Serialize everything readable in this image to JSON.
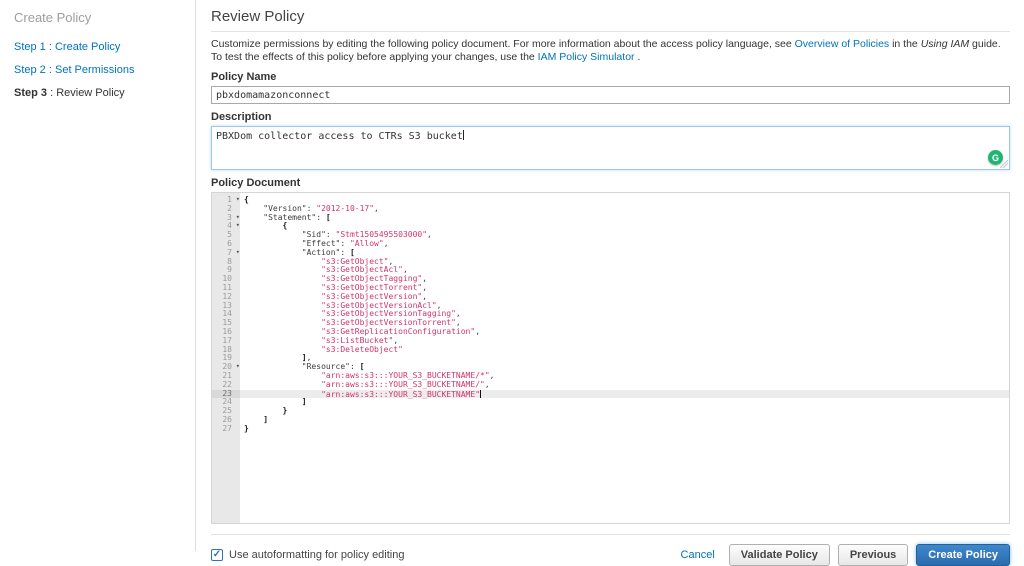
{
  "colors": {
    "link": "#0073bb",
    "string": "#d1356a",
    "primary": "#2e77c0"
  },
  "sidebar": {
    "title": "Create Policy",
    "sep": " : ",
    "steps": [
      {
        "prefix": "Step 1",
        "label": "Create Policy",
        "active": false
      },
      {
        "prefix": "Step 2",
        "label": "Set Permissions",
        "active": false
      },
      {
        "prefix": "Step 3",
        "label": "Review Policy",
        "active": true
      }
    ]
  },
  "header": {
    "title": "Review Policy",
    "intro": [
      {
        "text": "Customize permissions by editing the following policy document. For more information about the access policy language, see "
      },
      {
        "text": "Overview of Policies",
        "style": "link",
        "name": "overview-of-policies-link"
      },
      {
        "text": " in the "
      },
      {
        "text": "Using IAM",
        "style": "italic"
      },
      {
        "text": " guide. To test the effects of this policy before applying your changes, use the "
      },
      {
        "text": "IAM Policy Simulator",
        "style": "link",
        "name": "iam-policy-simulator-link"
      },
      {
        "text": " ."
      }
    ]
  },
  "form": {
    "policy_name": {
      "label": "Policy Name",
      "value": "pbxdomamazonconnect"
    },
    "description": {
      "label": "Description",
      "value": "PBXDom collector access to CTRs S3 bucket",
      "focused": true
    }
  },
  "editor": {
    "label": "Policy Document",
    "active_line": 23,
    "cursor_line": 23,
    "lines": [
      {
        "n": 1,
        "fold": true,
        "tokens": [
          [
            "b",
            "{"
          ]
        ]
      },
      {
        "n": 2,
        "fold": false,
        "tokens": [
          [
            "p",
            "    \"Version\": "
          ],
          [
            "s",
            "\"2012-10-17\""
          ],
          [
            "p",
            ","
          ]
        ]
      },
      {
        "n": 3,
        "fold": true,
        "tokens": [
          [
            "p",
            "    \"Statement\": "
          ],
          [
            "b",
            "["
          ]
        ]
      },
      {
        "n": 4,
        "fold": true,
        "tokens": [
          [
            "p",
            "        "
          ],
          [
            "b",
            "{"
          ]
        ]
      },
      {
        "n": 5,
        "fold": false,
        "tokens": [
          [
            "p",
            "            \"Sid\": "
          ],
          [
            "s",
            "\"Stmt1505495503000\""
          ],
          [
            "p",
            ","
          ]
        ]
      },
      {
        "n": 6,
        "fold": false,
        "tokens": [
          [
            "p",
            "            \"Effect\": "
          ],
          [
            "s",
            "\"Allow\""
          ],
          [
            "p",
            ","
          ]
        ]
      },
      {
        "n": 7,
        "fold": true,
        "tokens": [
          [
            "p",
            "            \"Action\": "
          ],
          [
            "b",
            "["
          ]
        ]
      },
      {
        "n": 8,
        "fold": false,
        "tokens": [
          [
            "p",
            "                "
          ],
          [
            "s",
            "\"s3:GetObject\""
          ],
          [
            "p",
            ","
          ]
        ]
      },
      {
        "n": 9,
        "fold": false,
        "tokens": [
          [
            "p",
            "                "
          ],
          [
            "s",
            "\"s3:GetObjectAcl\""
          ],
          [
            "p",
            ","
          ]
        ]
      },
      {
        "n": 10,
        "fold": false,
        "tokens": [
          [
            "p",
            "                "
          ],
          [
            "s",
            "\"s3:GetObjectTagging\""
          ],
          [
            "p",
            ","
          ]
        ]
      },
      {
        "n": 11,
        "fold": false,
        "tokens": [
          [
            "p",
            "                "
          ],
          [
            "s",
            "\"s3:GetObjectTorrent\""
          ],
          [
            "p",
            ","
          ]
        ]
      },
      {
        "n": 12,
        "fold": false,
        "tokens": [
          [
            "p",
            "                "
          ],
          [
            "s",
            "\"s3:GetObjectVersion\""
          ],
          [
            "p",
            ","
          ]
        ]
      },
      {
        "n": 13,
        "fold": false,
        "tokens": [
          [
            "p",
            "                "
          ],
          [
            "s",
            "\"s3:GetObjectVersionAcl\""
          ],
          [
            "p",
            ","
          ]
        ]
      },
      {
        "n": 14,
        "fold": false,
        "tokens": [
          [
            "p",
            "                "
          ],
          [
            "s",
            "\"s3:GetObjectVersionTagging\""
          ],
          [
            "p",
            ","
          ]
        ]
      },
      {
        "n": 15,
        "fold": false,
        "tokens": [
          [
            "p",
            "                "
          ],
          [
            "s",
            "\"s3:GetObjectVersionTorrent\""
          ],
          [
            "p",
            ","
          ]
        ]
      },
      {
        "n": 16,
        "fold": false,
        "tokens": [
          [
            "p",
            "                "
          ],
          [
            "s",
            "\"s3:GetReplicationConfiguration\""
          ],
          [
            "p",
            ","
          ]
        ]
      },
      {
        "n": 17,
        "fold": false,
        "tokens": [
          [
            "p",
            "                "
          ],
          [
            "s",
            "\"s3:ListBucket\""
          ],
          [
            "p",
            ","
          ]
        ]
      },
      {
        "n": 18,
        "fold": false,
        "tokens": [
          [
            "p",
            "                "
          ],
          [
            "s",
            "\"s3:DeleteObject\""
          ]
        ]
      },
      {
        "n": 19,
        "fold": false,
        "tokens": [
          [
            "p",
            "            "
          ],
          [
            "b",
            "]"
          ],
          [
            "p",
            ","
          ]
        ]
      },
      {
        "n": 20,
        "fold": true,
        "tokens": [
          [
            "p",
            "            \"Resource\": "
          ],
          [
            "b",
            "["
          ]
        ]
      },
      {
        "n": 21,
        "fold": false,
        "tokens": [
          [
            "p",
            "                "
          ],
          [
            "s",
            "\"arn:aws:s3:::YOUR_S3_BUCKETNAME/*\""
          ],
          [
            "p",
            ","
          ]
        ]
      },
      {
        "n": 22,
        "fold": false,
        "tokens": [
          [
            "p",
            "                "
          ],
          [
            "s",
            "\"arn:aws:s3:::YOUR_S3_BUCKETNAME/\""
          ],
          [
            "p",
            ","
          ]
        ]
      },
      {
        "n": 23,
        "fold": false,
        "tokens": [
          [
            "p",
            "                "
          ],
          [
            "s",
            "\"arn:aws:s3:::YOUR_S3_BUCKETNAME\""
          ]
        ]
      },
      {
        "n": 24,
        "fold": false,
        "tokens": [
          [
            "p",
            "            "
          ],
          [
            "b",
            "]"
          ]
        ]
      },
      {
        "n": 25,
        "fold": false,
        "tokens": [
          [
            "p",
            "        "
          ],
          [
            "b",
            "}"
          ]
        ]
      },
      {
        "n": 26,
        "fold": false,
        "tokens": [
          [
            "p",
            "    "
          ],
          [
            "b",
            "]"
          ]
        ]
      },
      {
        "n": 27,
        "fold": false,
        "tokens": [
          [
            "b",
            "}"
          ]
        ]
      }
    ]
  },
  "footer": {
    "autoformat_label": "Use autoformatting for policy editing",
    "autoformat_checked": true,
    "cancel": "Cancel",
    "validate": "Validate Policy",
    "previous": "Previous",
    "create": "Create Policy"
  }
}
